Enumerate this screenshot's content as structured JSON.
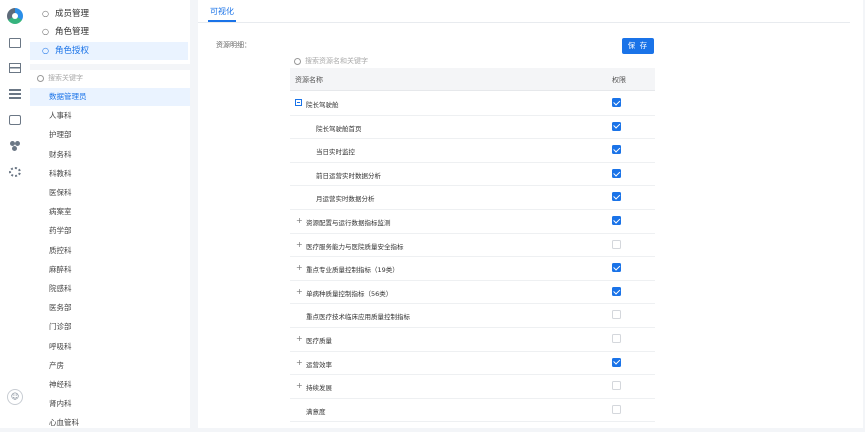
{
  "colors": {
    "accent": "#1a73e8",
    "active_bg": "#eaf3ff",
    "page_bg": "#f3f5f8"
  },
  "rail": {
    "icons": [
      "logo-icon",
      "monitor-icon",
      "calendar-icon",
      "list-icon",
      "mail-icon",
      "people-icon",
      "gear-icon"
    ],
    "avatar": "8"
  },
  "menu": {
    "items": [
      {
        "label": "成员管理",
        "icon": "user-icon"
      },
      {
        "label": "角色管理",
        "icon": "users-icon"
      },
      {
        "label": "角色授权",
        "icon": "users-icon",
        "active": true
      }
    ],
    "search_placeholder": "搜索关键字",
    "departments": [
      "数据管理员",
      "人事科",
      "护理部",
      "财务科",
      "科教科",
      "医保科",
      "病案室",
      "药学部",
      "质控科",
      "麻醉科",
      "院感科",
      "医务部",
      "门诊部",
      "呼吸科",
      "产房",
      "神经科",
      "肾内科",
      "心血管科"
    ],
    "selected_department": "数据管理员"
  },
  "main": {
    "tab_label": "可视化",
    "resource_label": "资源明细：",
    "save_button": "保 存",
    "table_search_placeholder": "搜索资源名和关键字",
    "columns": [
      "资源名称",
      "权限"
    ],
    "rows": [
      {
        "name": "院长驾驶舱",
        "level": 0,
        "expand": "collapse",
        "checked": true
      },
      {
        "name": "院长驾驶舱首页",
        "level": 1,
        "expand": "none",
        "checked": true
      },
      {
        "name": "当日实时监控",
        "level": 1,
        "expand": "none",
        "checked": true
      },
      {
        "name": "前日运营实时数据分析",
        "level": 1,
        "expand": "none",
        "checked": true
      },
      {
        "name": "月运营实时数据分析",
        "level": 1,
        "expand": "none",
        "checked": true
      },
      {
        "name": "资源配置与运行数据指标监测",
        "level": 0,
        "expand": "plus",
        "checked": true
      },
      {
        "name": "医疗服务能力与医院质量安全指标",
        "level": 0,
        "expand": "plus",
        "checked": false
      },
      {
        "name": "重点专业质量控制指标（19类）",
        "level": 0,
        "expand": "plus",
        "checked": true
      },
      {
        "name": "单病种质量控制指标（56类）",
        "level": 0,
        "expand": "plus",
        "checked": true
      },
      {
        "name": "重点医疗技术临床应用质量控制指标",
        "level": 0,
        "expand": "none",
        "checked": false
      },
      {
        "name": "医疗质量",
        "level": 0,
        "expand": "plus",
        "checked": false
      },
      {
        "name": "运营效率",
        "level": 0,
        "expand": "plus",
        "checked": true
      },
      {
        "name": "持续发展",
        "level": 0,
        "expand": "plus",
        "checked": false
      },
      {
        "name": "满意度",
        "level": 0,
        "expand": "none",
        "checked": false
      }
    ]
  }
}
